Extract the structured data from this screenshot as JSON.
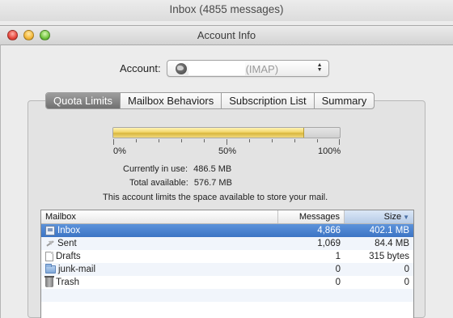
{
  "parent_window": {
    "title": "Inbox (4855 messages)"
  },
  "window": {
    "title": "Account Info"
  },
  "account": {
    "label": "Account:",
    "name": "",
    "type": "(IMAP)"
  },
  "tabs": [
    {
      "label": "Quota Limits",
      "active": true
    },
    {
      "label": "Mailbox Behaviors",
      "active": false
    },
    {
      "label": "Subscription List",
      "active": false
    },
    {
      "label": "Summary",
      "active": false
    }
  ],
  "quota": {
    "fraction_used": 0.844,
    "tick_labels": [
      "0%",
      "50%",
      "100%"
    ],
    "in_use_label": "Currently in use:",
    "in_use_value": "486.5 MB",
    "available_label": "Total available:",
    "available_value": "576.7 MB",
    "note": "This account limits the space available to store your mail."
  },
  "table": {
    "headers": {
      "mailbox": "Mailbox",
      "messages": "Messages",
      "size": "Size"
    },
    "sort_column": "size",
    "rows": [
      {
        "icon": "inbox-icon",
        "mailbox": "Inbox",
        "messages": "4,866",
        "size": "402.1 MB",
        "selected": true
      },
      {
        "icon": "sent-icon",
        "mailbox": "Sent",
        "messages": "1,069",
        "size": "84.4 MB",
        "selected": false
      },
      {
        "icon": "drafts-icon",
        "mailbox": "Drafts",
        "messages": "1",
        "size": "315 bytes",
        "selected": false
      },
      {
        "icon": "folder-icon",
        "mailbox": "junk-mail",
        "messages": "0",
        "size": "0",
        "selected": false
      },
      {
        "icon": "trash-icon",
        "mailbox": "Trash",
        "messages": "0",
        "size": "0",
        "selected": false
      }
    ]
  },
  "colors": {
    "selection": "#3c74c4",
    "quota_fill": "#e6c84f",
    "close": "#e5463c",
    "minimize": "#f3b73b",
    "zoom": "#71c440"
  }
}
